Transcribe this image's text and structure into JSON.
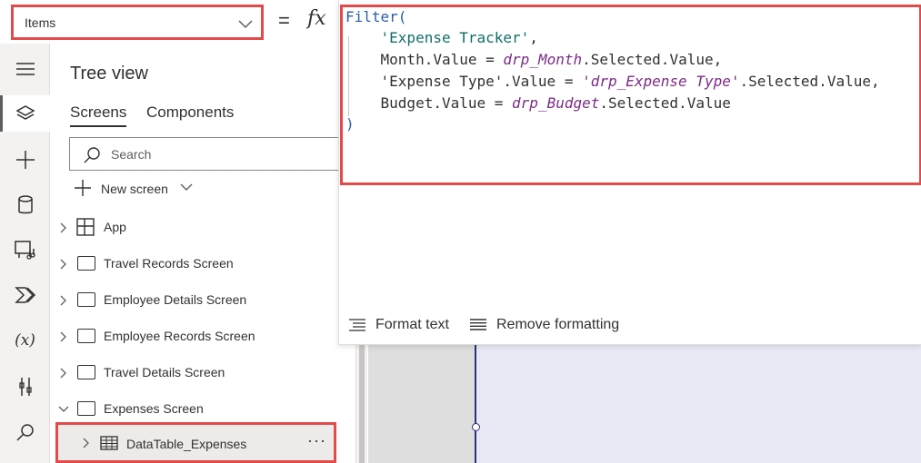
{
  "formula_bar": {
    "property": "Items",
    "equals": "=",
    "fx": "fx"
  },
  "formula": {
    "line1": {
      "fn": "Filter",
      "paren": "("
    },
    "line2": {
      "indent": "    ",
      "source": "'Expense Tracker'",
      "comma": ","
    },
    "line3": {
      "indent": "    ",
      "field": "Month.Value",
      "op": " = ",
      "ctrl": "drp_Month",
      "rest": ".Selected.Value,"
    },
    "line4": {
      "indent": "    ",
      "field": "'Expense Type'.Value",
      "op": " = ",
      "ctrl": "'drp_Expense Type'",
      "rest": ".Selected.Value,"
    },
    "line5": {
      "indent": "    ",
      "field": "Budget.Value",
      "op": " = ",
      "ctrl": "drp_Budget",
      "rest": ".Selected.Value"
    },
    "line6": {
      "fn": ")"
    }
  },
  "editor_toolbar": {
    "format_text": "Format text",
    "remove_formatting": "Remove formatting"
  },
  "left_rail": {
    "icons": [
      "hamburger-icon",
      "layers-icon",
      "plus-icon",
      "database-icon",
      "media-icon",
      "power-automate-icon",
      "variables-icon",
      "tools-icon",
      "search-icon"
    ],
    "variables_label": "(x)"
  },
  "tree_view": {
    "title": "Tree view",
    "tabs": {
      "screens": "Screens",
      "components": "Components"
    },
    "search_placeholder": "Search",
    "new_screen": "New screen",
    "items": [
      {
        "label": "App"
      },
      {
        "label": "Travel Records Screen"
      },
      {
        "label": "Employee Details Screen"
      },
      {
        "label": "Employee Records Screen"
      },
      {
        "label": "Travel Details Screen"
      },
      {
        "label": "Expenses Screen"
      }
    ],
    "selected_child": {
      "label": "DataTable_Expenses",
      "more": "···"
    }
  },
  "colors": {
    "highlight": "#e34a4a",
    "function": "#2a5ea8",
    "string": "#0f6e68",
    "control": "#7b2b86",
    "canvas_screen": "#e7eaf5"
  }
}
